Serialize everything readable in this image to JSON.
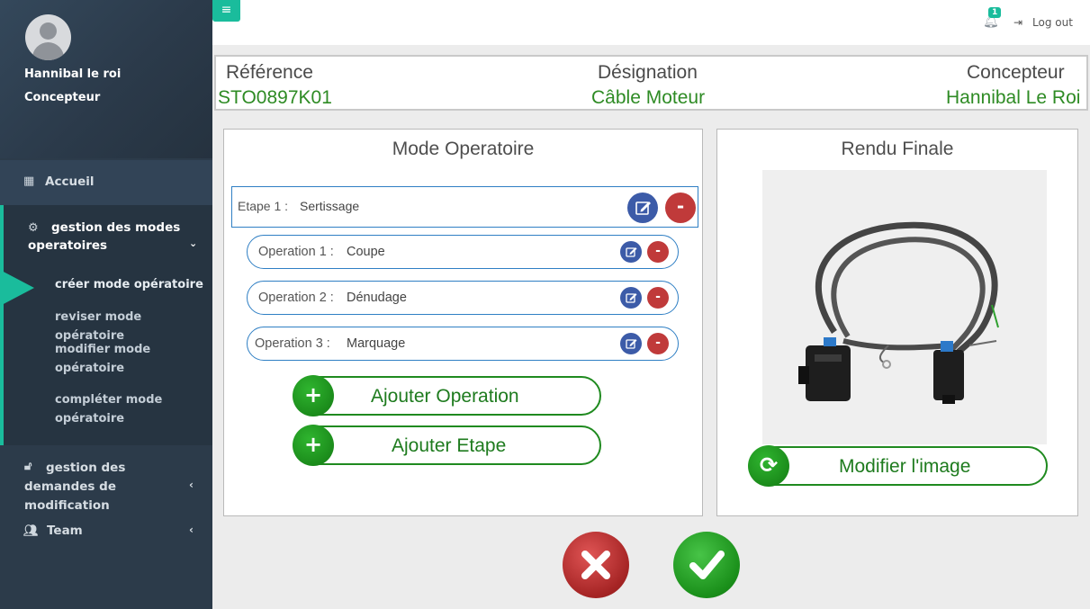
{
  "sidebar": {
    "profile": {
      "name": "Hannibal le roi",
      "role": "Concepteur"
    },
    "items": [
      {
        "label": "Accueil"
      },
      {
        "label": "gestion des modes operatoires",
        "sub": [
          "créer mode opératoire",
          "reviser mode opératoire",
          "modifier mode opératoire",
          "compléter mode opératoire"
        ]
      },
      {
        "label": "gestion des demandes de modification"
      },
      {
        "label": "Team"
      }
    ]
  },
  "topbar": {
    "notification_count": "1",
    "logout_label": "Log out"
  },
  "header": {
    "reference_label": "Référence",
    "reference_value": "STO0897K01",
    "designation_label": "Désignation",
    "designation_value": "Câble Moteur",
    "concepteur_label": "Concepteur",
    "concepteur_value": "Hannibal Le Roi"
  },
  "mode_operatoire": {
    "title": "Mode Operatoire",
    "etape": {
      "label": "Etape 1 :",
      "value": "Sertissage"
    },
    "operations": [
      {
        "label": "Operation 1 :",
        "value": "Coupe"
      },
      {
        "label": "Operation 2 :",
        "value": "Dénudage"
      },
      {
        "label": "Operation 3 :",
        "value": "Marquage"
      }
    ],
    "add_operation_label": "Ajouter Operation",
    "add_etape_label": "Ajouter Etape"
  },
  "rendu": {
    "title": "Rendu Finale",
    "modify_image_label": "Modifier l'image"
  },
  "colors": {
    "accent": "#1abc9c",
    "green": "#2e8b24",
    "blue": "#2f7fc4",
    "red": "#c03a3a"
  }
}
